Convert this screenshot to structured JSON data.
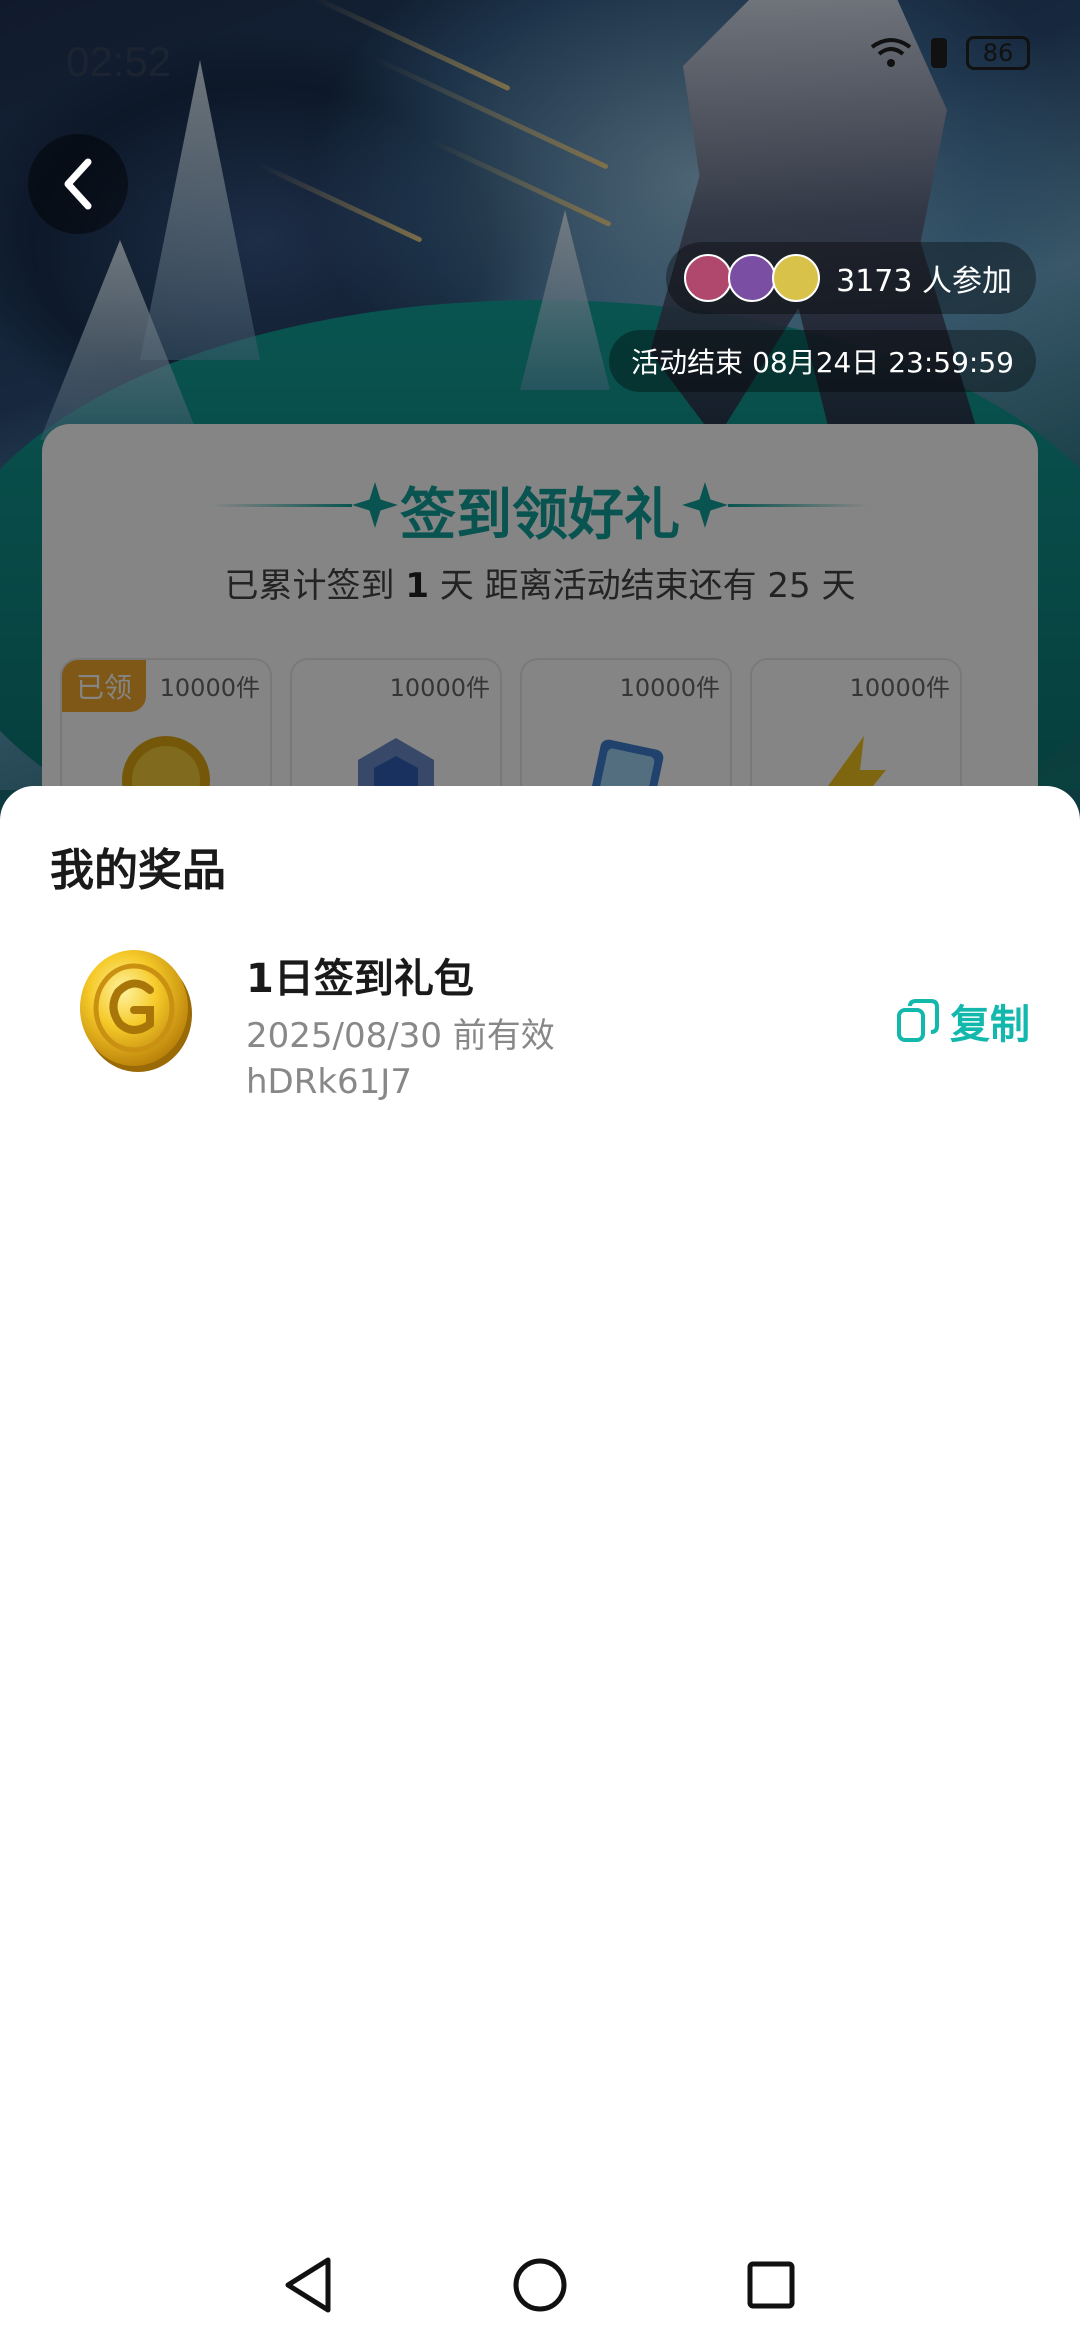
{
  "status_bar": {
    "time": "02:52",
    "battery": "86"
  },
  "hero": {
    "participants_text": "3173 人参加",
    "end_time_text": "活动结束 08月24日 23:59:59"
  },
  "card": {
    "title": "签到领好礼",
    "sub_prefix": "已累计签到",
    "sub_days": "1",
    "sub_suffix": "天  距离活动结束还有 25 天",
    "rewards": [
      {
        "count": "10000件",
        "badge": "已领",
        "icon": "gold-coin-icon"
      },
      {
        "count": "10000件",
        "icon": "gem-badge-icon"
      },
      {
        "count": "10000件",
        "icon": "card-icon"
      },
      {
        "count": "10000件",
        "icon": "lightning-icon"
      }
    ]
  },
  "sheet": {
    "title": "我的奖品",
    "prize": {
      "name": "1日签到礼包",
      "valid": "2025/08/30 前有效",
      "code": "hDRk61J7",
      "copy_label": "复制"
    }
  },
  "colors": {
    "accent": "#13b8ad",
    "badge": "#f3a92c"
  }
}
